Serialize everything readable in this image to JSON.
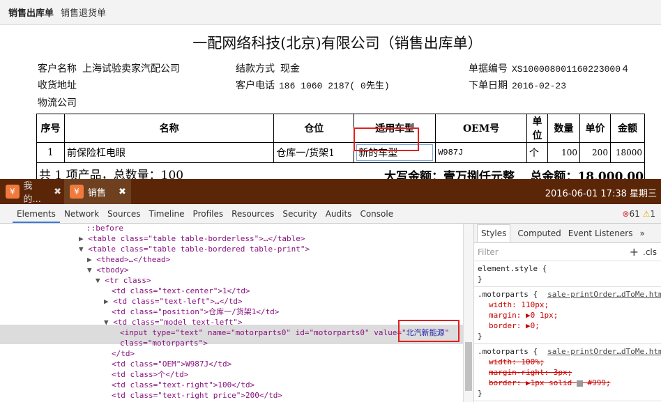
{
  "topnav": {
    "tabs": [
      "销售出库单",
      "销售退货单"
    ]
  },
  "doc": {
    "title": "一配网络科技(北京)有限公司（销售出库单）",
    "fields": [
      {
        "label": "客户名称",
        "value": "上海试验卖家汽配公司"
      },
      {
        "label": "结款方式",
        "value": "现金"
      },
      {
        "label": "单据编号",
        "value": "XS100008001160223000４"
      },
      {
        "label": "收货地址",
        "value": ""
      },
      {
        "label": "客户电话",
        "value": "186 1060 2187( 0先生)"
      },
      {
        "label": "下单日期",
        "value": "2016-02-23"
      },
      {
        "label": "物流公司",
        "value": ""
      }
    ],
    "table": {
      "headers": [
        "序号",
        "名称",
        "仓位",
        "适用车型",
        "OEM号",
        "单位",
        "数量",
        "单价",
        "金额"
      ],
      "row": {
        "no": "1",
        "name": "前保险杠电眼",
        "position": "仓库一/货架1",
        "model": "新的车型",
        "oem": "W987J",
        "unit": "个",
        "qty": "100",
        "price": "200",
        "amount": "18000"
      },
      "footer": {
        "summary": "共 1 项产品，总数量：100",
        "capital": "大写金额：壹万捌仟元整",
        "total": "总金额：18,000.00"
      }
    }
  },
  "browser": {
    "tabs": [
      {
        "label": "我的...",
        "icon": "¥"
      },
      {
        "label": "销售",
        "icon": "¥"
      }
    ],
    "close": "✖",
    "clock": "2016-06-01 17:38 星期三"
  },
  "devtools": {
    "tabs": [
      "Elements",
      "Network",
      "Sources",
      "Timeline",
      "Profiles",
      "Resources",
      "Security",
      "Audits",
      "Console"
    ],
    "errors": "61",
    "warnings": "1",
    "dom": [
      {
        "t": "::before"
      },
      {
        "t": "<table class=\"table table-borderless\">…</table>"
      },
      {
        "t": "<table class=\"table table-bordered table-print\">"
      },
      {
        "t": "<thead>…</thead>"
      },
      {
        "t": "<tbody>"
      },
      {
        "t": "<tr class>"
      },
      {
        "t": "<td class=\"text-center\">1</td>"
      },
      {
        "t": "<td class=\"text-left\">…</td>"
      },
      {
        "t": "<td class=\"position\">仓库一/货架1</td>"
      },
      {
        "t": "<td class=\"model text-left\">"
      },
      {
        "t": "<input type=\"text\" name=\"motorparts0\" id=\"motorparts0\" value=\""
      },
      {
        "t": "class=\"motorparts\">"
      },
      {
        "t": "</td>"
      },
      {
        "t": "<td class=\"OEM\">W987J</td>"
      },
      {
        "t": "<td class>个</td>"
      },
      {
        "t": "<td class=\"text-right\">100</td>"
      },
      {
        "t": "<td class=\"text-right price\">200</td>"
      },
      {
        "t": "<td class=\"text-right money\">18000</td>"
      }
    ],
    "input_value": "北汽新能源",
    "styles": {
      "tabs": [
        "Styles",
        "Computed",
        "Event Listeners",
        "»"
      ],
      "filter": "Filter",
      "plus": "+",
      "cls": ".cls",
      "element_style": "element.style {",
      "close": "}",
      "rule1": {
        "selector": ".motorparts {",
        "source": "sale-printOrder…dToMe.htm",
        "props": [
          "width: 110px;",
          "margin: ▶0 1px;",
          "border: ▶0;"
        ]
      },
      "rule2": {
        "selector": ".motorparts {",
        "source": "sale-printOrder…dToMe.htm",
        "props": [
          "width: 100%;",
          "margin-right: 3px;",
          "border: ▶1px solid ",
          "#999;"
        ]
      }
    }
  }
}
